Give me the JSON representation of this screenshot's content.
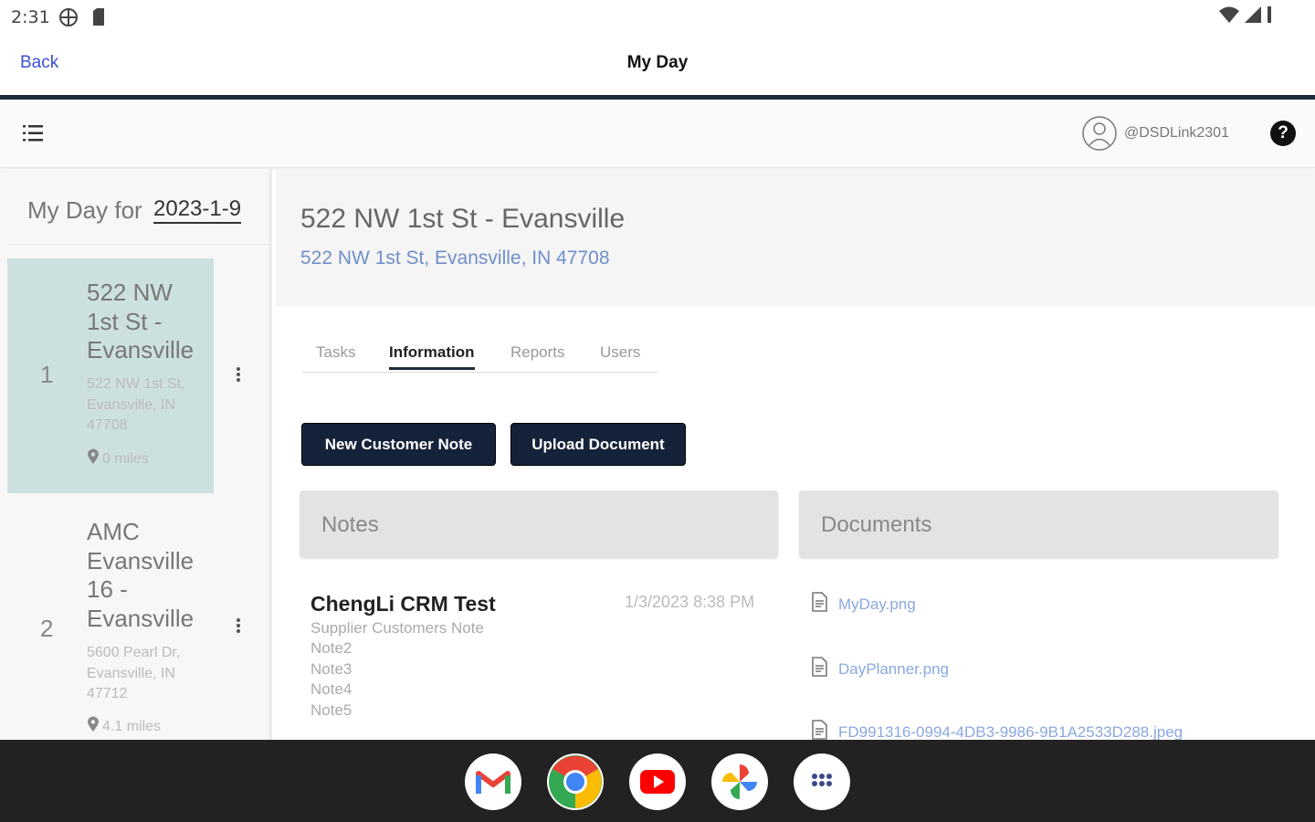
{
  "status_bar": {
    "time": "2:31",
    "icons": [
      "vpn-icon",
      "sim-card-icon",
      "wifi-icon",
      "signal-icon",
      "battery-icon"
    ]
  },
  "app_header": {
    "back_label": "Back",
    "title": "My Day"
  },
  "toolbar": {
    "user_handle": "@DSDLink2301",
    "help_label": "?"
  },
  "left_panel": {
    "my_day_label": "My Day for",
    "date": "2023-1-9",
    "stops": [
      {
        "number": "1",
        "name": "522 NW 1st St - Evansville",
        "address": "522 NW 1st St, Evansville, IN 47708",
        "distance": "0 miles",
        "selected": true
      },
      {
        "number": "2",
        "name": "AMC Evansville 16 - Evansville",
        "address": "5600 Pearl Dr, Evansville, IN 47712",
        "distance": "4.1 miles",
        "selected": false
      }
    ]
  },
  "main": {
    "location_title": "522 NW 1st St - Evansville",
    "location_address": "522 NW 1st St, Evansville, IN 47708",
    "tabs": [
      {
        "label": "Tasks",
        "active": false
      },
      {
        "label": "Information",
        "active": true
      },
      {
        "label": "Reports",
        "active": false
      },
      {
        "label": "Users",
        "active": false
      }
    ],
    "buttons": {
      "new_note": "New Customer Note",
      "upload": "Upload Document"
    },
    "notes_header": "Notes",
    "documents_header": "Documents",
    "note": {
      "author": "ChengLi CRM Test",
      "timestamp": "1/3/2023 8:38 PM",
      "lines": [
        "Supplier Customers Note",
        "Note2",
        "Note3",
        "Note4",
        "Note5"
      ]
    },
    "documents": [
      {
        "name": "MyDay.png"
      },
      {
        "name": "DayPlanner.png"
      },
      {
        "name": "FD991316-0994-4DB3-9986-9B1A2533D288.jpeg"
      }
    ]
  },
  "taskbar": {
    "apps": [
      "gmail-icon",
      "chrome-icon",
      "youtube-icon",
      "photos-icon",
      "app-drawer-icon"
    ]
  },
  "colors": {
    "accent": "#15233a",
    "link": "#3b4fd8",
    "selected_stop": "#cde0e0"
  }
}
